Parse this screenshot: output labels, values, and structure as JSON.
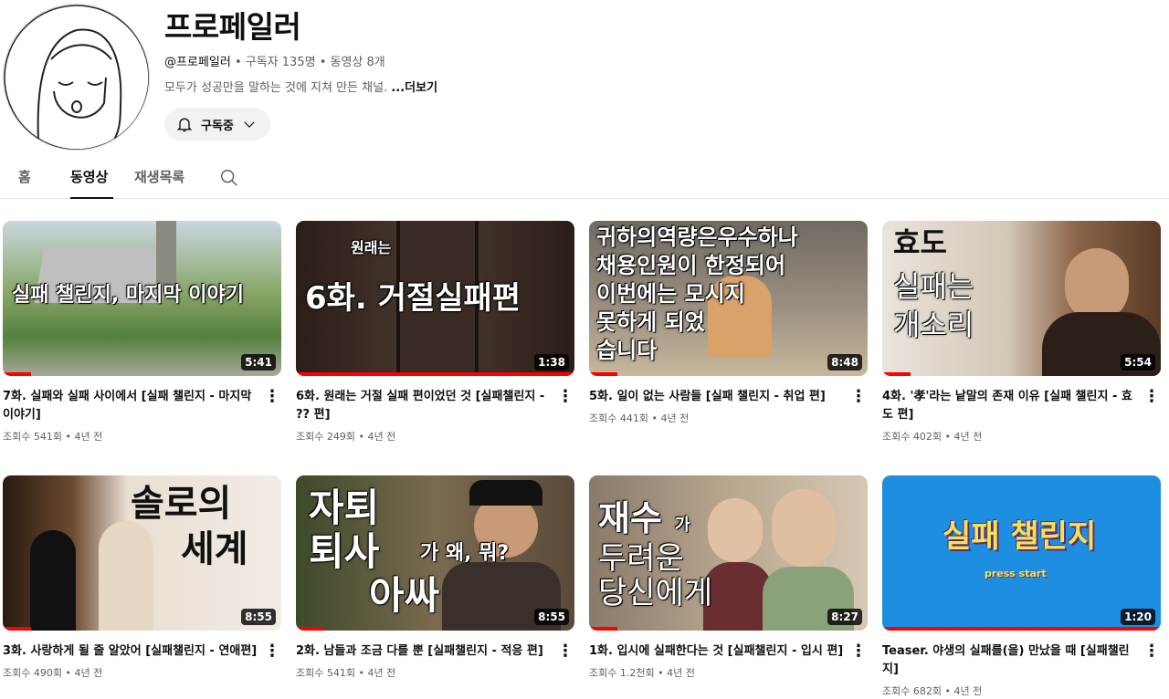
{
  "channel": {
    "name": "프로페일러",
    "handle": "@프로페일러",
    "subscribers": "구독자 135명",
    "video_count": "동영상 8개",
    "description": "모두가 성공만을 말하는 것에 지쳐 만든 채널.",
    "more_label": "...더보기",
    "subscribe_label": "구독중"
  },
  "tabs": [
    {
      "label": "홈"
    },
    {
      "label": "동영상"
    },
    {
      "label": "재생목록"
    }
  ],
  "separator": "•",
  "videos": [
    {
      "title": "7화. 실패와 실패 사이에서 [실패 챌린지 - 마지막 이야기]",
      "duration": "5:41",
      "views": "조회수 541회",
      "age": "4년 전",
      "thumb_text": [
        "실패 챌린지, 마지막 이야기"
      ],
      "progress": 0.1
    },
    {
      "title": "6화. 원래는 거절 실패 편이었던 것 [실패챌린지 - ?? 편]",
      "duration": "1:38",
      "views": "조회수 249회",
      "age": "4년 전",
      "thumb_text": [
        "원래는",
        "6화. 거절실패편"
      ],
      "progress": 1.0
    },
    {
      "title": "5화. 일이 없는 사람들 [실패 챌린지 - 취업 편]",
      "duration": "8:48",
      "views": "조회수 441회",
      "age": "4년 전",
      "thumb_text": [
        "귀하의역량은우수하나",
        "채용인원이   한정되어",
        "이번에는        모시지",
        "못하게            되었",
        "습니다"
      ],
      "progress": 0.1
    },
    {
      "title": "4화. '孝'라는 낱말의 존재 이유 [실패 챌린지 - 효도 편]",
      "duration": "5:54",
      "views": "조회수 402회",
      "age": "4년 전",
      "thumb_text": [
        "효도",
        "실패는",
        "개소리"
      ],
      "progress": 0.1
    },
    {
      "title": "3화. 사랑하게 될 줄 알았어 [실패챌린지 - 연애편]",
      "duration": "8:55",
      "views": "조회수 490회",
      "age": "4년 전",
      "thumb_text": [
        "솔로의",
        "세계"
      ],
      "progress": 0.1
    },
    {
      "title": "2화. 남들과 조금 다를 뿐 [실패챌린지 - 적응 편]",
      "duration": "8:55",
      "views": "조회수 541회",
      "age": "4년 전",
      "thumb_text": [
        "자퇴",
        "퇴사",
        "가 왜, 뭐?",
        "아싸"
      ],
      "progress": 0.1
    },
    {
      "title": "1화. 입시에 실패한다는 것 [실패챌린지 - 입시 편]",
      "duration": "8:27",
      "views": "조회수 1.2천회",
      "age": "4년 전",
      "thumb_text": [
        "재수",
        "가",
        "두려운",
        "당신에게"
      ],
      "progress": 0.1
    },
    {
      "title": "Teaser. 야생의 실패를(을) 만났을 때 [실패챌린지]",
      "duration": "1:20",
      "views": "조회수 682회",
      "age": "4년 전",
      "thumb_text": [
        "실패 챌린지",
        "press start"
      ],
      "progress": 1.0
    }
  ],
  "colors": {
    "accent": "#ff0000",
    "text_primary": "#0f0f0f",
    "text_secondary": "#606060",
    "chip_bg": "#f2f2f2",
    "teaser_bg": "#1e8fe0"
  },
  "icons": {
    "subscribe": "bell-icon",
    "dropdown": "chevron-down-icon",
    "search": "search-icon",
    "menu": "more-vert-icon"
  }
}
